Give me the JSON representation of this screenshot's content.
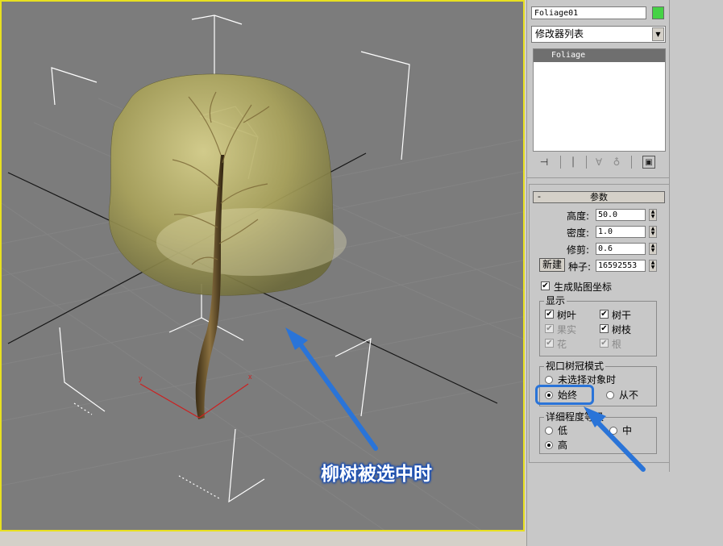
{
  "viewport": {
    "caption": "柳树被选中时",
    "axis_labels": {
      "x": "x",
      "y": "y"
    },
    "border_color": "#e8e020",
    "background_color": "#7c7c7c"
  },
  "command_panel": {
    "object_name": "Foliage01",
    "object_color": "#45d245",
    "modifier_list": "修改器列表",
    "stack": [
      "Foliage"
    ],
    "stack_icons": [
      "pin-stack-icon",
      "show-end-result-icon",
      "make-unique-icon",
      "remove-modifier-icon",
      "configure-modifier-sets-icon"
    ]
  },
  "parameters": {
    "rollout_title": "参数",
    "collapse_symbol": "-",
    "height_label": "高度:",
    "height_value": "50.0",
    "density_label": "密度:",
    "density_value": "1.0",
    "prune_label": "修剪:",
    "prune_value": "0.6",
    "new_button": "新建",
    "seed_label": "种子:",
    "seed_value": "16592553",
    "gen_mapping_label": "生成贴图坐标",
    "gen_mapping_checked": true,
    "display_group": {
      "title": "显示",
      "items": [
        {
          "label": "树叶",
          "checked": true,
          "enabled": true
        },
        {
          "label": "树干",
          "checked": true,
          "enabled": true
        },
        {
          "label": "果实",
          "checked": true,
          "enabled": false
        },
        {
          "label": "树枝",
          "checked": true,
          "enabled": true
        },
        {
          "label": "花",
          "checked": true,
          "enabled": false
        },
        {
          "label": "根",
          "checked": true,
          "enabled": false
        }
      ]
    },
    "canopy_group": {
      "title": "视口树冠模式",
      "options": [
        "未选择对象时",
        "始终",
        "从不"
      ],
      "selected": "始终"
    },
    "lod_group": {
      "title": "详细程度等级",
      "options": [
        "低",
        "中",
        "高"
      ],
      "selected": "高"
    },
    "check_mark": "✔"
  },
  "annotation": {
    "highlight_color": "#2a74d8"
  }
}
